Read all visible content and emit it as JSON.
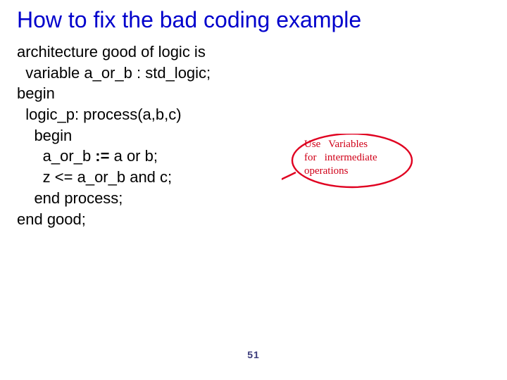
{
  "title": "How to fix the bad coding example",
  "code": {
    "line1": "architecture good of logic is",
    "line2": "  variable a_or_b : std_logic;",
    "line3": "begin",
    "line4": "  logic_p: process(a,b,c)",
    "line5": "    begin",
    "line6_pre": "      a_or_b ",
    "line6_op": ":=",
    "line6_post": " a or b;",
    "line7": "      z <= a_or_b and c;",
    "line8": "    end process;",
    "line9": "end good;"
  },
  "annotation": {
    "line1": "Use   Variables",
    "line2": "for   intermediate",
    "line3": "operations"
  },
  "page_number": "51",
  "colors": {
    "title": "#0000cc",
    "annotation": "#d00018",
    "arrow": "#e00020",
    "page_number": "#3a3a7a"
  }
}
